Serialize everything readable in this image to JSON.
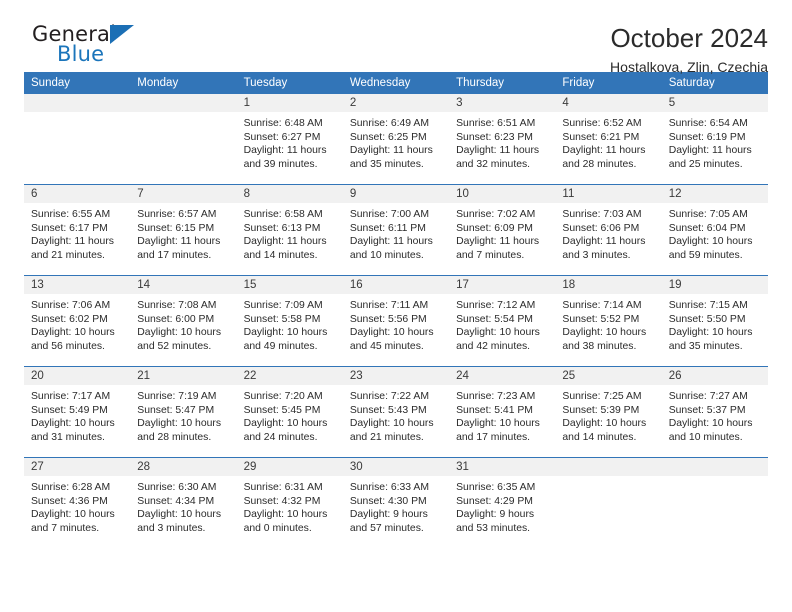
{
  "brand": {
    "word_one": "General",
    "word_two": "Blue",
    "triangle_icon": "blue-triangle-icon",
    "blue": "#1b75bb"
  },
  "header": {
    "title": "October 2024",
    "subtitle": "Hostalkova, Zlin, Czechia"
  },
  "theme": {
    "header_blue": "#3275b8",
    "date_band": "#f1f1f1",
    "text": "#2b2b2b"
  },
  "calendar": {
    "day_headers": [
      "Sunday",
      "Monday",
      "Tuesday",
      "Wednesday",
      "Thursday",
      "Friday",
      "Saturday"
    ],
    "labels": {
      "sunrise": "Sunrise:",
      "sunset": "Sunset:",
      "daylight": "Daylight:"
    },
    "weeks": [
      [
        {
          "date": "",
          "blank": true,
          "sunrise": "",
          "sunset": "",
          "daylight_line1": "",
          "daylight_line2": ""
        },
        {
          "date": "",
          "blank": true,
          "sunrise": "",
          "sunset": "",
          "daylight_line1": "",
          "daylight_line2": ""
        },
        {
          "date": "1",
          "sunrise": "Sunrise: 6:48 AM",
          "sunset": "Sunset: 6:27 PM",
          "daylight_line1": "Daylight: 11 hours",
          "daylight_line2": "and 39 minutes."
        },
        {
          "date": "2",
          "sunrise": "Sunrise: 6:49 AM",
          "sunset": "Sunset: 6:25 PM",
          "daylight_line1": "Daylight: 11 hours",
          "daylight_line2": "and 35 minutes."
        },
        {
          "date": "3",
          "sunrise": "Sunrise: 6:51 AM",
          "sunset": "Sunset: 6:23 PM",
          "daylight_line1": "Daylight: 11 hours",
          "daylight_line2": "and 32 minutes."
        },
        {
          "date": "4",
          "sunrise": "Sunrise: 6:52 AM",
          "sunset": "Sunset: 6:21 PM",
          "daylight_line1": "Daylight: 11 hours",
          "daylight_line2": "and 28 minutes."
        },
        {
          "date": "5",
          "sunrise": "Sunrise: 6:54 AM",
          "sunset": "Sunset: 6:19 PM",
          "daylight_line1": "Daylight: 11 hours",
          "daylight_line2": "and 25 minutes."
        }
      ],
      [
        {
          "date": "6",
          "sunrise": "Sunrise: 6:55 AM",
          "sunset": "Sunset: 6:17 PM",
          "daylight_line1": "Daylight: 11 hours",
          "daylight_line2": "and 21 minutes."
        },
        {
          "date": "7",
          "sunrise": "Sunrise: 6:57 AM",
          "sunset": "Sunset: 6:15 PM",
          "daylight_line1": "Daylight: 11 hours",
          "daylight_line2": "and 17 minutes."
        },
        {
          "date": "8",
          "sunrise": "Sunrise: 6:58 AM",
          "sunset": "Sunset: 6:13 PM",
          "daylight_line1": "Daylight: 11 hours",
          "daylight_line2": "and 14 minutes."
        },
        {
          "date": "9",
          "sunrise": "Sunrise: 7:00 AM",
          "sunset": "Sunset: 6:11 PM",
          "daylight_line1": "Daylight: 11 hours",
          "daylight_line2": "and 10 minutes."
        },
        {
          "date": "10",
          "sunrise": "Sunrise: 7:02 AM",
          "sunset": "Sunset: 6:09 PM",
          "daylight_line1": "Daylight: 11 hours",
          "daylight_line2": "and 7 minutes."
        },
        {
          "date": "11",
          "sunrise": "Sunrise: 7:03 AM",
          "sunset": "Sunset: 6:06 PM",
          "daylight_line1": "Daylight: 11 hours",
          "daylight_line2": "and 3 minutes."
        },
        {
          "date": "12",
          "sunrise": "Sunrise: 7:05 AM",
          "sunset": "Sunset: 6:04 PM",
          "daylight_line1": "Daylight: 10 hours",
          "daylight_line2": "and 59 minutes."
        }
      ],
      [
        {
          "date": "13",
          "sunrise": "Sunrise: 7:06 AM",
          "sunset": "Sunset: 6:02 PM",
          "daylight_line1": "Daylight: 10 hours",
          "daylight_line2": "and 56 minutes."
        },
        {
          "date": "14",
          "sunrise": "Sunrise: 7:08 AM",
          "sunset": "Sunset: 6:00 PM",
          "daylight_line1": "Daylight: 10 hours",
          "daylight_line2": "and 52 minutes."
        },
        {
          "date": "15",
          "sunrise": "Sunrise: 7:09 AM",
          "sunset": "Sunset: 5:58 PM",
          "daylight_line1": "Daylight: 10 hours",
          "daylight_line2": "and 49 minutes."
        },
        {
          "date": "16",
          "sunrise": "Sunrise: 7:11 AM",
          "sunset": "Sunset: 5:56 PM",
          "daylight_line1": "Daylight: 10 hours",
          "daylight_line2": "and 45 minutes."
        },
        {
          "date": "17",
          "sunrise": "Sunrise: 7:12 AM",
          "sunset": "Sunset: 5:54 PM",
          "daylight_line1": "Daylight: 10 hours",
          "daylight_line2": "and 42 minutes."
        },
        {
          "date": "18",
          "sunrise": "Sunrise: 7:14 AM",
          "sunset": "Sunset: 5:52 PM",
          "daylight_line1": "Daylight: 10 hours",
          "daylight_line2": "and 38 minutes."
        },
        {
          "date": "19",
          "sunrise": "Sunrise: 7:15 AM",
          "sunset": "Sunset: 5:50 PM",
          "daylight_line1": "Daylight: 10 hours",
          "daylight_line2": "and 35 minutes."
        }
      ],
      [
        {
          "date": "20",
          "sunrise": "Sunrise: 7:17 AM",
          "sunset": "Sunset: 5:49 PM",
          "daylight_line1": "Daylight: 10 hours",
          "daylight_line2": "and 31 minutes."
        },
        {
          "date": "21",
          "sunrise": "Sunrise: 7:19 AM",
          "sunset": "Sunset: 5:47 PM",
          "daylight_line1": "Daylight: 10 hours",
          "daylight_line2": "and 28 minutes."
        },
        {
          "date": "22",
          "sunrise": "Sunrise: 7:20 AM",
          "sunset": "Sunset: 5:45 PM",
          "daylight_line1": "Daylight: 10 hours",
          "daylight_line2": "and 24 minutes."
        },
        {
          "date": "23",
          "sunrise": "Sunrise: 7:22 AM",
          "sunset": "Sunset: 5:43 PM",
          "daylight_line1": "Daylight: 10 hours",
          "daylight_line2": "and 21 minutes."
        },
        {
          "date": "24",
          "sunrise": "Sunrise: 7:23 AM",
          "sunset": "Sunset: 5:41 PM",
          "daylight_line1": "Daylight: 10 hours",
          "daylight_line2": "and 17 minutes."
        },
        {
          "date": "25",
          "sunrise": "Sunrise: 7:25 AM",
          "sunset": "Sunset: 5:39 PM",
          "daylight_line1": "Daylight: 10 hours",
          "daylight_line2": "and 14 minutes."
        },
        {
          "date": "26",
          "sunrise": "Sunrise: 7:27 AM",
          "sunset": "Sunset: 5:37 PM",
          "daylight_line1": "Daylight: 10 hours",
          "daylight_line2": "and 10 minutes."
        }
      ],
      [
        {
          "date": "27",
          "sunrise": "Sunrise: 6:28 AM",
          "sunset": "Sunset: 4:36 PM",
          "daylight_line1": "Daylight: 10 hours",
          "daylight_line2": "and 7 minutes."
        },
        {
          "date": "28",
          "sunrise": "Sunrise: 6:30 AM",
          "sunset": "Sunset: 4:34 PM",
          "daylight_line1": "Daylight: 10 hours",
          "daylight_line2": "and 3 minutes."
        },
        {
          "date": "29",
          "sunrise": "Sunrise: 6:31 AM",
          "sunset": "Sunset: 4:32 PM",
          "daylight_line1": "Daylight: 10 hours",
          "daylight_line2": "and 0 minutes."
        },
        {
          "date": "30",
          "sunrise": "Sunrise: 6:33 AM",
          "sunset": "Sunset: 4:30 PM",
          "daylight_line1": "Daylight: 9 hours",
          "daylight_line2": "and 57 minutes."
        },
        {
          "date": "31",
          "sunrise": "Sunrise: 6:35 AM",
          "sunset": "Sunset: 4:29 PM",
          "daylight_line1": "Daylight: 9 hours",
          "daylight_line2": "and 53 minutes."
        },
        {
          "date": "",
          "blank": true,
          "sunrise": "",
          "sunset": "",
          "daylight_line1": "",
          "daylight_line2": ""
        },
        {
          "date": "",
          "blank": true,
          "sunrise": "",
          "sunset": "",
          "daylight_line1": "",
          "daylight_line2": ""
        }
      ]
    ]
  }
}
